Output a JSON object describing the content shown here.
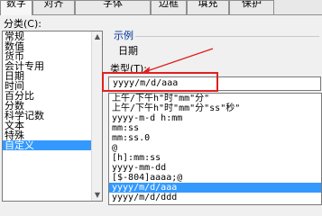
{
  "tabs": [
    {
      "label": "数字"
    },
    {
      "label": "对齐"
    },
    {
      "label": "字体"
    },
    {
      "label": "边框"
    },
    {
      "label": "填充"
    },
    {
      "label": "保护"
    }
  ],
  "category": {
    "label": "分类(C):",
    "items": [
      "常规",
      "数值",
      "货币",
      "会计专用",
      "日期",
      "时间",
      "百分比",
      "分数",
      "科学记数",
      "文本",
      "特殊",
      "自定义"
    ],
    "selected_index": 11
  },
  "sample": {
    "label": "示例",
    "value": "日期"
  },
  "type": {
    "label": "类型(T):",
    "value": "yyyy/m/d/aaa"
  },
  "formats": {
    "items": [
      "上午/下午h\"时\"mm\"分\"",
      "上午/下午h\"时\"mm\"分\"ss\"秒\"",
      "yyyy-m-d h:mm",
      "mm:ss",
      "mm:ss.0",
      "@",
      "[h]:mm:ss",
      "yyyy-mm-dd",
      "[$-804]aaaa;@",
      "yyyy/m/d/aaa",
      "yyyy/m/d/ddd"
    ],
    "selected_index": 9
  },
  "colors": {
    "selection": "#3399ff",
    "annotation": "#e02020",
    "sample_label": "#003399"
  }
}
